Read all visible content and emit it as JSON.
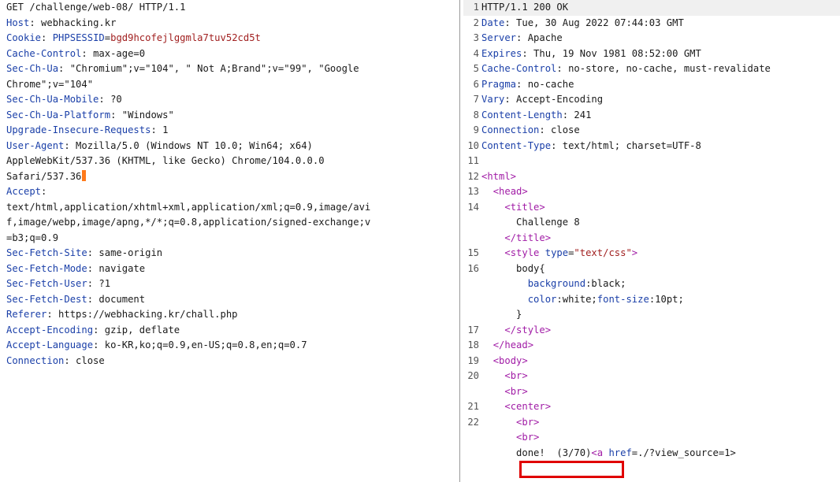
{
  "request": {
    "lines": [
      {
        "segs": [
          {
            "c": "v",
            "t": "GET /challenge/web-08/ HTTP/1.1"
          }
        ]
      },
      {
        "segs": [
          {
            "c": "k",
            "t": "Host"
          },
          {
            "c": "v",
            "t": ": webhacking.kr"
          }
        ]
      },
      {
        "segs": [
          {
            "c": "k",
            "t": "Cookie"
          },
          {
            "c": "v",
            "t": ": "
          },
          {
            "c": "k",
            "t": "PHPSESSID"
          },
          {
            "c": "v",
            "t": "="
          },
          {
            "c": "cookie-v",
            "t": "bgd9hcofejlggmla7tuv52cd5t"
          }
        ]
      },
      {
        "segs": [
          {
            "c": "k",
            "t": "Cache-Control"
          },
          {
            "c": "v",
            "t": ": max-age=0"
          }
        ]
      },
      {
        "segs": [
          {
            "c": "k",
            "t": "Sec-Ch-Ua"
          },
          {
            "c": "v",
            "t": ": \"Chromium\";v=\"104\", \" Not A;Brand\";v=\"99\", \"Google"
          }
        ]
      },
      {
        "segs": [
          {
            "c": "v",
            "t": "Chrome\";v=\"104\""
          }
        ]
      },
      {
        "segs": [
          {
            "c": "k",
            "t": "Sec-Ch-Ua-Mobile"
          },
          {
            "c": "v",
            "t": ": ?0"
          }
        ]
      },
      {
        "segs": [
          {
            "c": "k",
            "t": "Sec-Ch-Ua-Platform"
          },
          {
            "c": "v",
            "t": ": \"Windows\""
          }
        ]
      },
      {
        "segs": [
          {
            "c": "k",
            "t": "Upgrade-Insecure-Requests"
          },
          {
            "c": "v",
            "t": ": 1"
          }
        ]
      },
      {
        "segs": [
          {
            "c": "k",
            "t": "User-Agent"
          },
          {
            "c": "v",
            "t": ": Mozilla/5.0 (Windows NT 10.0; Win64; x64)"
          }
        ]
      },
      {
        "segs": [
          {
            "c": "v",
            "t": "AppleWebKit/537.36 (KHTML, like Gecko) Chrome/104.0.0.0"
          }
        ]
      },
      {
        "segs": [
          {
            "c": "v",
            "t": "Safari/537.36"
          }
        ],
        "caret": true
      },
      {
        "segs": [
          {
            "c": "k",
            "t": "Accept"
          },
          {
            "c": "v",
            "t": ":"
          }
        ]
      },
      {
        "segs": [
          {
            "c": "v",
            "t": "text/html,application/xhtml+xml,application/xml;q=0.9,image/avi"
          }
        ]
      },
      {
        "segs": [
          {
            "c": "v",
            "t": "f,image/webp,image/apng,*/*;q=0.8,application/signed-exchange;v"
          }
        ]
      },
      {
        "segs": [
          {
            "c": "v",
            "t": "=b3;q=0.9"
          }
        ]
      },
      {
        "segs": [
          {
            "c": "k",
            "t": "Sec-Fetch-Site"
          },
          {
            "c": "v",
            "t": ": same-origin"
          }
        ]
      },
      {
        "segs": [
          {
            "c": "k",
            "t": "Sec-Fetch-Mode"
          },
          {
            "c": "v",
            "t": ": navigate"
          }
        ]
      },
      {
        "segs": [
          {
            "c": "k",
            "t": "Sec-Fetch-User"
          },
          {
            "c": "v",
            "t": ": ?1"
          }
        ]
      },
      {
        "segs": [
          {
            "c": "k",
            "t": "Sec-Fetch-Dest"
          },
          {
            "c": "v",
            "t": ": document"
          }
        ]
      },
      {
        "segs": [
          {
            "c": "k",
            "t": "Referer"
          },
          {
            "c": "v",
            "t": ": https://webhacking.kr/chall.php"
          }
        ]
      },
      {
        "segs": [
          {
            "c": "k",
            "t": "Accept-Encoding"
          },
          {
            "c": "v",
            "t": ": gzip, deflate"
          }
        ]
      },
      {
        "segs": [
          {
            "c": "k",
            "t": "Accept-Language"
          },
          {
            "c": "v",
            "t": ": ko-KR,ko;q=0.9,en-US;q=0.8,en;q=0.7"
          }
        ]
      },
      {
        "segs": [
          {
            "c": "k",
            "t": "Connection"
          },
          {
            "c": "v",
            "t": ": close"
          }
        ]
      }
    ]
  },
  "response": {
    "lines": [
      {
        "n": "1",
        "hl": true,
        "segs": [
          {
            "c": "txt",
            "t": "HTTP/1.1 200 OK"
          }
        ]
      },
      {
        "n": "2",
        "segs": [
          {
            "c": "attr",
            "t": "Date"
          },
          {
            "c": "txt",
            "t": ": Tue, 30 Aug 2022 07:44:03 GMT"
          }
        ]
      },
      {
        "n": "3",
        "segs": [
          {
            "c": "attr",
            "t": "Server"
          },
          {
            "c": "txt",
            "t": ": Apache"
          }
        ]
      },
      {
        "n": "4",
        "segs": [
          {
            "c": "attr",
            "t": "Expires"
          },
          {
            "c": "txt",
            "t": ": Thu, 19 Nov 1981 08:52:00 GMT"
          }
        ]
      },
      {
        "n": "5",
        "segs": [
          {
            "c": "attr",
            "t": "Cache-Control"
          },
          {
            "c": "txt",
            "t": ": no-store, no-cache, must-revalidate"
          }
        ]
      },
      {
        "n": "6",
        "segs": [
          {
            "c": "attr",
            "t": "Pragma"
          },
          {
            "c": "txt",
            "t": ": no-cache"
          }
        ]
      },
      {
        "n": "7",
        "segs": [
          {
            "c": "attr",
            "t": "Vary"
          },
          {
            "c": "txt",
            "t": ": Accept-Encoding"
          }
        ]
      },
      {
        "n": "8",
        "segs": [
          {
            "c": "attr",
            "t": "Content-Length"
          },
          {
            "c": "txt",
            "t": ": 241"
          }
        ]
      },
      {
        "n": "9",
        "segs": [
          {
            "c": "attr",
            "t": "Connection"
          },
          {
            "c": "txt",
            "t": ": close"
          }
        ]
      },
      {
        "n": "10",
        "segs": [
          {
            "c": "attr",
            "t": "Content-Type"
          },
          {
            "c": "txt",
            "t": ": text/html; charset=UTF-8"
          }
        ]
      },
      {
        "n": "11",
        "segs": []
      },
      {
        "n": "12",
        "segs": [
          {
            "c": "tag",
            "t": "<html>"
          }
        ]
      },
      {
        "n": "13",
        "segs": [
          {
            "c": "txt",
            "t": "  "
          },
          {
            "c": "tag",
            "t": "<head>"
          }
        ]
      },
      {
        "n": "14",
        "segs": [
          {
            "c": "txt",
            "t": "    "
          },
          {
            "c": "tag",
            "t": "<title>"
          }
        ]
      },
      {
        "n": "",
        "segs": [
          {
            "c": "txt",
            "t": "      Challenge 8"
          }
        ]
      },
      {
        "n": "",
        "segs": [
          {
            "c": "txt",
            "t": "    "
          },
          {
            "c": "tag",
            "t": "</title>"
          }
        ]
      },
      {
        "n": "15",
        "segs": [
          {
            "c": "txt",
            "t": "    "
          },
          {
            "c": "tag",
            "t": "<style"
          },
          {
            "c": "attr",
            "t": " type"
          },
          {
            "c": "txt",
            "t": "="
          },
          {
            "c": "str",
            "t": "\"text/css\""
          },
          {
            "c": "tag",
            "t": ">"
          }
        ]
      },
      {
        "n": "16",
        "segs": [
          {
            "c": "txt",
            "t": "      body{"
          }
        ]
      },
      {
        "n": "",
        "segs": [
          {
            "c": "txt",
            "t": "        "
          },
          {
            "c": "attr",
            "t": "background"
          },
          {
            "c": "txt",
            "t": ":black;"
          }
        ]
      },
      {
        "n": "",
        "segs": [
          {
            "c": "txt",
            "t": "        "
          },
          {
            "c": "attr",
            "t": "color"
          },
          {
            "c": "txt",
            "t": ":white;"
          },
          {
            "c": "attr",
            "t": "font-size"
          },
          {
            "c": "txt",
            "t": ":10pt;"
          }
        ]
      },
      {
        "n": "",
        "segs": [
          {
            "c": "txt",
            "t": "      }"
          }
        ]
      },
      {
        "n": "17",
        "segs": [
          {
            "c": "txt",
            "t": "    "
          },
          {
            "c": "tag",
            "t": "</style>"
          }
        ]
      },
      {
        "n": "18",
        "segs": [
          {
            "c": "txt",
            "t": "  "
          },
          {
            "c": "tag",
            "t": "</head>"
          }
        ]
      },
      {
        "n": "19",
        "segs": [
          {
            "c": "txt",
            "t": "  "
          },
          {
            "c": "tag",
            "t": "<body>"
          }
        ]
      },
      {
        "n": "20",
        "segs": [
          {
            "c": "txt",
            "t": "    "
          },
          {
            "c": "tag",
            "t": "<br>"
          }
        ]
      },
      {
        "n": "",
        "segs": [
          {
            "c": "txt",
            "t": "    "
          },
          {
            "c": "tag",
            "t": "<br>"
          }
        ]
      },
      {
        "n": "21",
        "segs": [
          {
            "c": "txt",
            "t": "    "
          },
          {
            "c": "tag",
            "t": "<center>"
          }
        ]
      },
      {
        "n": "22",
        "segs": [
          {
            "c": "txt",
            "t": "      "
          },
          {
            "c": "tag",
            "t": "<br>"
          }
        ]
      },
      {
        "n": "",
        "segs": [
          {
            "c": "txt",
            "t": "      "
          },
          {
            "c": "tag",
            "t": "<br>"
          }
        ]
      },
      {
        "n": "",
        "segs": [
          {
            "c": "txt",
            "t": "      done!  (3/70)"
          },
          {
            "c": "tag",
            "t": "<a"
          },
          {
            "c": "attr",
            "t": " href"
          },
          {
            "c": "txt",
            "t": "=./?view_source=1>"
          }
        ]
      }
    ]
  }
}
